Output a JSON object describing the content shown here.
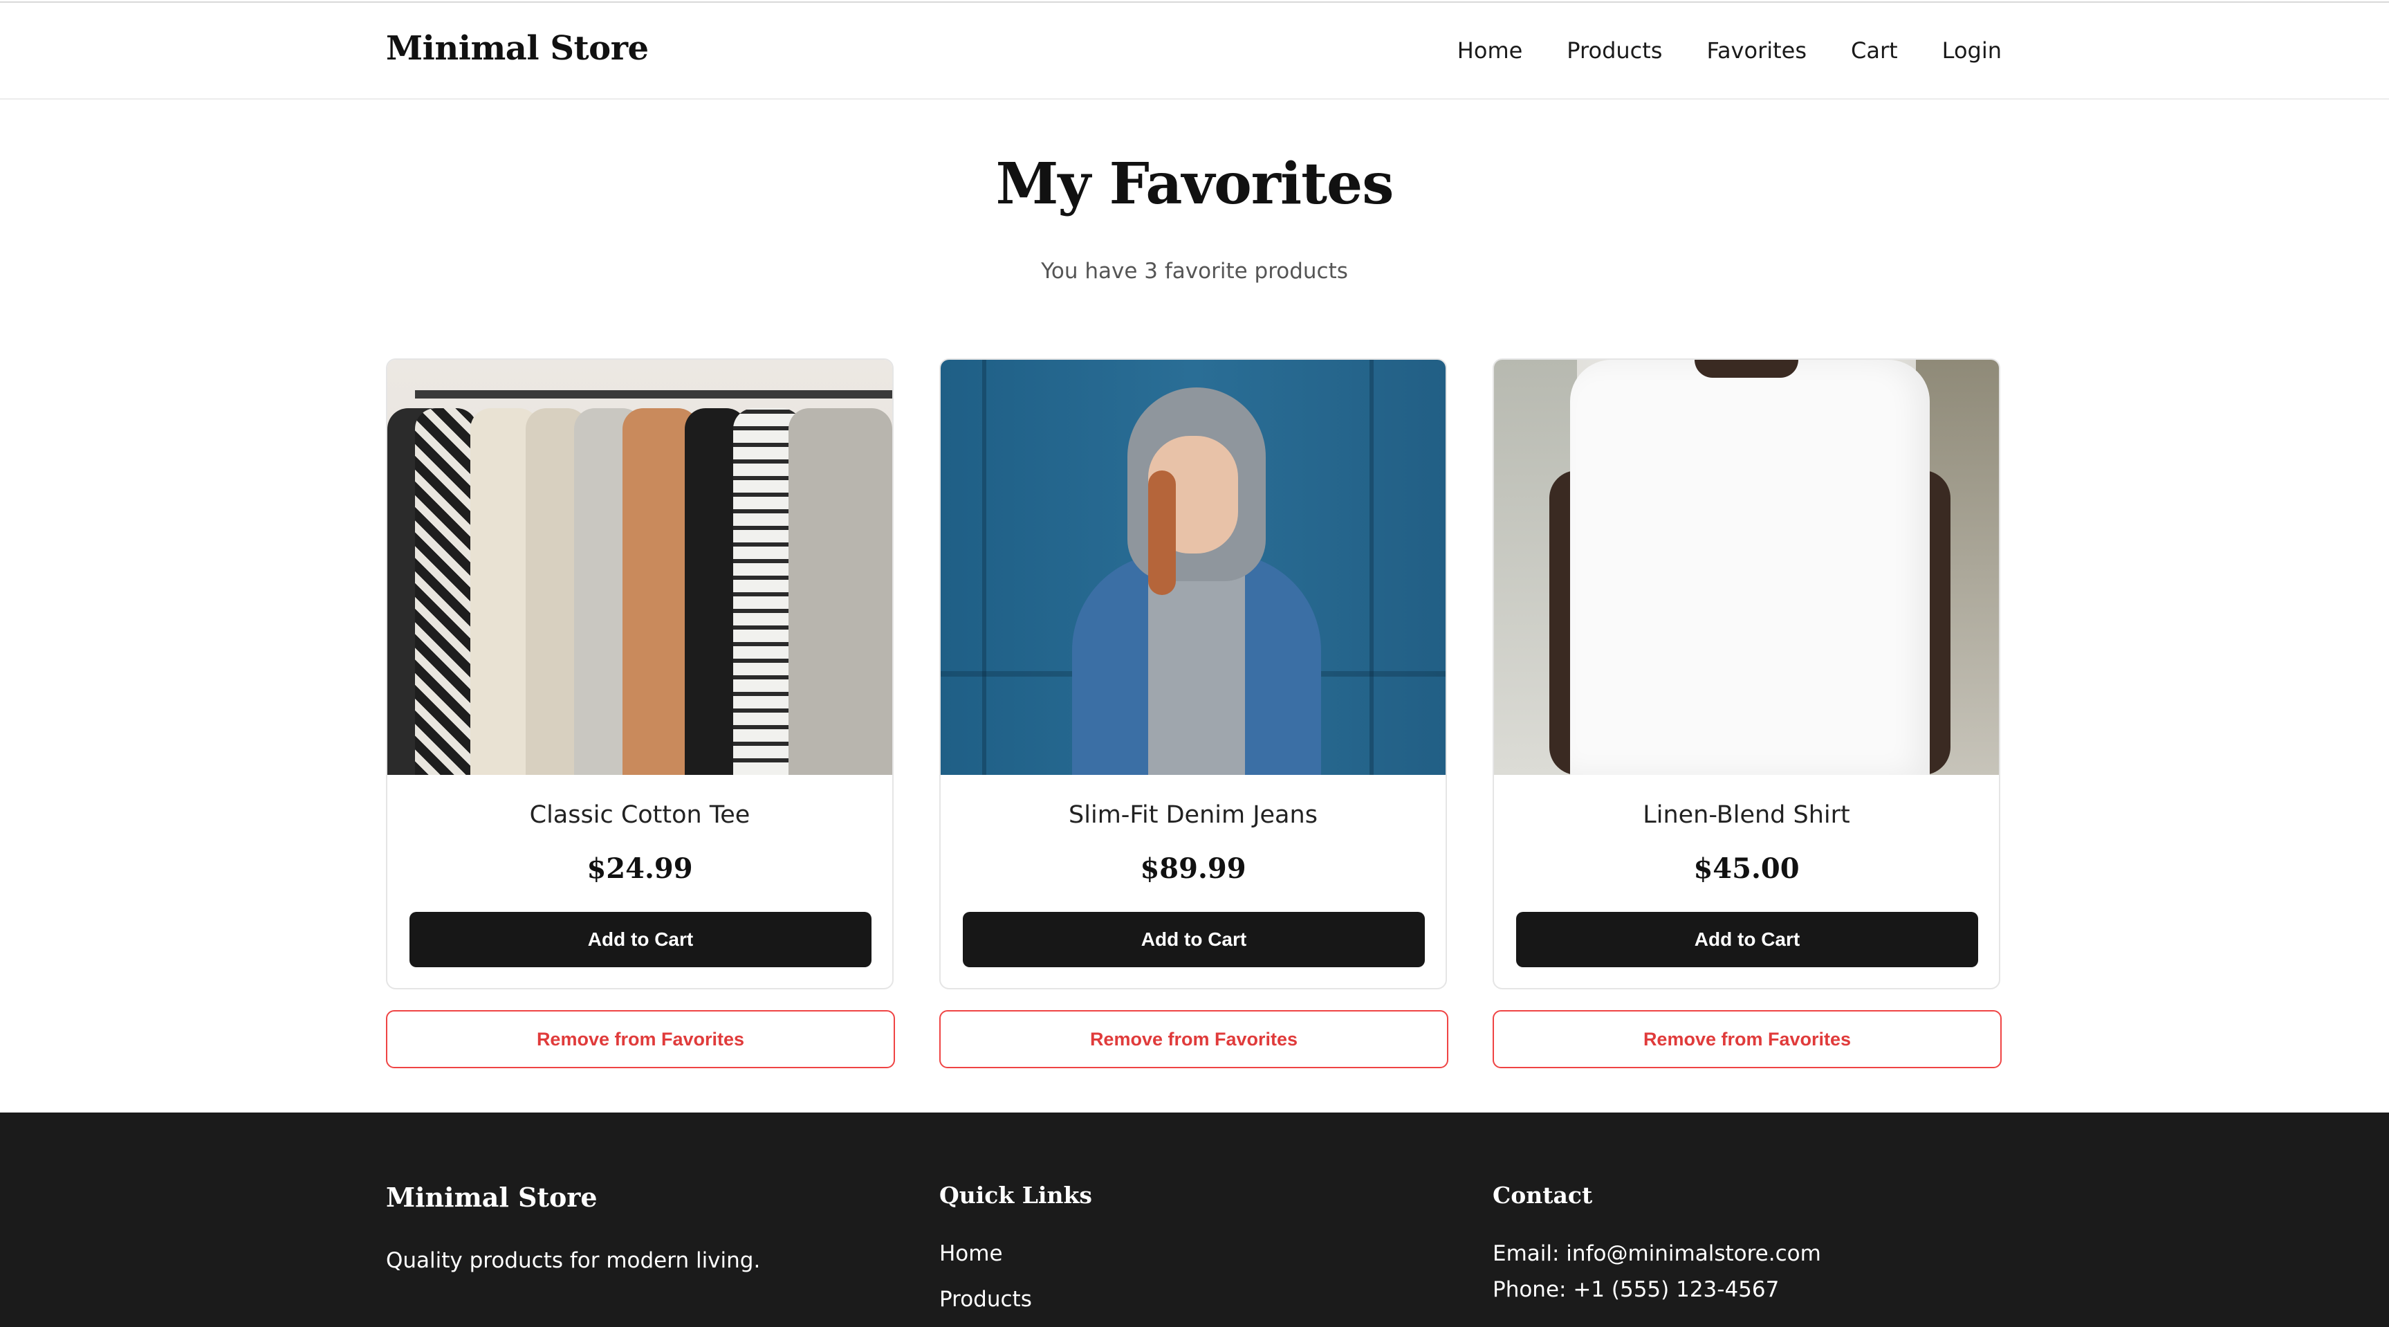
{
  "header": {
    "brand": "Minimal Store",
    "nav": [
      {
        "label": "Home"
      },
      {
        "label": "Products"
      },
      {
        "label": "Favorites"
      },
      {
        "label": "Cart"
      },
      {
        "label": "Login"
      }
    ]
  },
  "main": {
    "title": "My Favorites",
    "subtitle": "You have 3 favorite products",
    "products": [
      {
        "name": "Classic Cotton Tee",
        "price": "$24.99",
        "add_label": "Add to Cart",
        "remove_label": "Remove from Favorites"
      },
      {
        "name": "Slim-Fit Denim Jeans",
        "price": "$89.99",
        "add_label": "Add to Cart",
        "remove_label": "Remove from Favorites"
      },
      {
        "name": "Linen-Blend Shirt",
        "price": "$45.00",
        "add_label": "Add to Cart",
        "remove_label": "Remove from Favorites"
      }
    ]
  },
  "footer": {
    "brand": "Minimal Store",
    "tagline": "Quality products for modern living.",
    "quick_links_heading": "Quick Links",
    "quick_links": [
      "Home",
      "Products"
    ],
    "contact_heading": "Contact",
    "email": "Email: info@minimalstore.com",
    "phone": "Phone: +1 (555) 123-4567"
  },
  "colors": {
    "primary_button": "#171717",
    "danger": "#ef4444",
    "footer_bg": "#1b1b1b"
  }
}
